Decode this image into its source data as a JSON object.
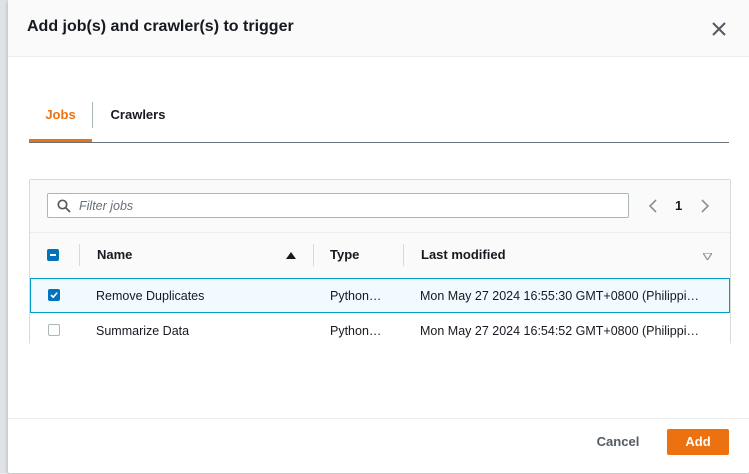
{
  "modal": {
    "title": "Add job(s) and crawler(s) to trigger"
  },
  "tabs": [
    {
      "label": "Jobs",
      "active": true
    },
    {
      "label": "Crawlers",
      "active": false
    }
  ],
  "filter": {
    "placeholder": "Filter jobs",
    "value": ""
  },
  "pagination": {
    "current_page": "1"
  },
  "table": {
    "columns": [
      "Name",
      "Type",
      "Last modified"
    ],
    "sort_column": "Name",
    "rows": [
      {
        "name": "Remove Duplicates",
        "type": "Python…",
        "last_modified": "Mon May 27 2024 16:55:30 GMT+0800 (Philippi…",
        "checked": true
      },
      {
        "name": "Summarize Data",
        "type": "Python…",
        "last_modified": "Mon May 27 2024 16:54:52 GMT+0800 (Philippi…",
        "checked": false
      }
    ]
  },
  "footer": {
    "cancel_label": "Cancel",
    "add_label": "Add"
  },
  "colors": {
    "accent": "#ec7211",
    "selection": "#0073bb",
    "selected_row_bg": "#f1faff",
    "selected_row_border": "#00a1c9"
  }
}
